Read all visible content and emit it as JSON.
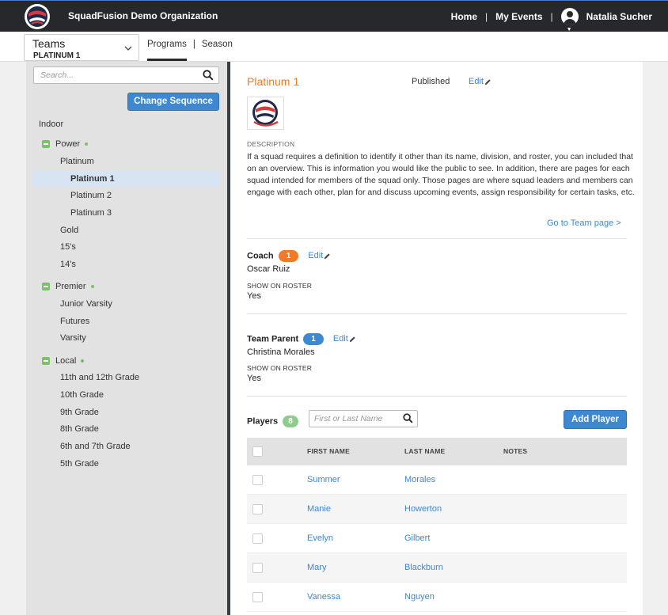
{
  "header": {
    "org_name": "SquadFusion Demo Organization",
    "nav": [
      "Home",
      "My Events"
    ],
    "separator": "|",
    "user_name": "Natalia Sucher"
  },
  "subheader": {
    "select_label": "Teams",
    "select_value": "PLATINUM 1",
    "tabs": [
      "Programs",
      "Season"
    ],
    "tab_separator": "|"
  },
  "sidebar": {
    "search_placeholder": "Search...",
    "change_sequence_label": "Change Sequence",
    "root": "Indoor",
    "groups": [
      {
        "name": "Power",
        "items": [
          "Platinum",
          "Platinum 1",
          "Platinum 2",
          "Platinum 3",
          "Gold",
          "15's",
          "14's"
        ]
      },
      {
        "name": "Premier",
        "items": [
          "Junior Varsity",
          "Futures",
          "Varsity"
        ]
      },
      {
        "name": "Local",
        "items": [
          "11th and 12th Grade",
          "10th Grade",
          "9th Grade",
          "8th Grade",
          "6th and 7th Grade",
          "5th Grade"
        ]
      }
    ],
    "selected": "Platinum 1"
  },
  "team": {
    "name": "Platinum 1",
    "status": "Published",
    "edit_label": "Edit",
    "description_label": "DESCRIPTION",
    "description": "If a squad requires a definition to identify it other than its name, division, and roster, you can included that on an overview. This is information you would like the public to see. In addition, there are pages for each squad intended for members of the squad only. Those pages are where squad leaders and members can engage with each other, plan for and discuss upcoming events, assign responsibility for certain tasks, etc.",
    "go_to_team": "Go to Team page >"
  },
  "coach": {
    "label": "Coach",
    "count": "1",
    "edit_label": "Edit",
    "name": "Oscar Ruiz",
    "show_on_roster_label": "SHOW ON ROSTER",
    "show_on_roster_value": "Yes"
  },
  "team_parent": {
    "label": "Team Parent",
    "count": "1",
    "edit_label": "Edit",
    "name": "Christina Morales",
    "show_on_roster_label": "SHOW ON ROSTER",
    "show_on_roster_value": "Yes"
  },
  "players": {
    "label": "Players",
    "count": "8",
    "search_placeholder": "First or Last Name",
    "add_label": "Add Player",
    "columns": [
      "FIRST NAME",
      "LAST NAME",
      "NOTES"
    ],
    "rows": [
      {
        "first": "Summer",
        "last": "Morales"
      },
      {
        "first": "Manie",
        "last": "Howerton"
      },
      {
        "first": "Evelyn",
        "last": "Gilbert"
      },
      {
        "first": "Mary",
        "last": "Blackburn"
      },
      {
        "first": "Vanessa",
        "last": "Nguyen"
      }
    ]
  },
  "colors": {
    "accent": "#3d88d0",
    "title": "#f07a25",
    "topbar": "#26282c",
    "toggle": "#7cc06a"
  }
}
